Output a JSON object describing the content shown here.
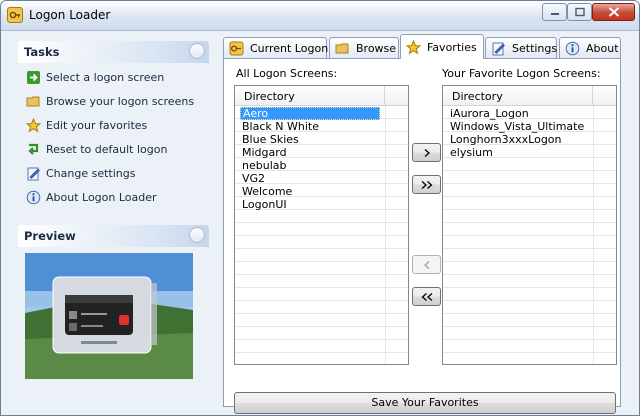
{
  "window": {
    "title": "Logon Loader"
  },
  "tasks_panel": {
    "heading": "Tasks",
    "items": [
      {
        "label": "Select a logon screen",
        "icon": "green-arrow-icon"
      },
      {
        "label": "Browse your logon screens",
        "icon": "folder-icon"
      },
      {
        "label": "Edit your favorites",
        "icon": "star-icon"
      },
      {
        "label": "Reset to default logon",
        "icon": "reset-arrow-icon"
      },
      {
        "label": "Change settings",
        "icon": "settings-icon"
      },
      {
        "label": "About Logon Loader",
        "icon": "info-icon"
      }
    ]
  },
  "preview_panel": {
    "heading": "Preview"
  },
  "tabs": [
    {
      "label": "Current Logon",
      "icon": "key-icon"
    },
    {
      "label": "Browse",
      "icon": "folder-icon"
    },
    {
      "label": "Favorties",
      "icon": "star-icon",
      "active": true
    },
    {
      "label": "Settings",
      "icon": "settings-icon"
    },
    {
      "label": "About",
      "icon": "info-icon"
    }
  ],
  "favorites": {
    "all_caption": "All Logon Screens:",
    "fav_caption": "Your Favorite Logon Screens:",
    "column_header": "Directory",
    "all_items": [
      "Aero",
      "Black N White",
      "Blue Skies",
      "Midgard",
      "nebulab",
      "VG2",
      "Welcome",
      "LogonUI"
    ],
    "selected_index": 0,
    "fav_items": [
      "iAurora_Logon",
      "Windows_Vista_Ultimate",
      "Longhorn3xxxLogon",
      "elysium"
    ],
    "buttons": {
      "add": ">",
      "add_all": ">>",
      "remove": "<",
      "remove_all": "<<"
    },
    "save_label": "Save Your Favorites"
  },
  "colors": {
    "selection": "#3399ff",
    "accent": "#1b2a45"
  }
}
